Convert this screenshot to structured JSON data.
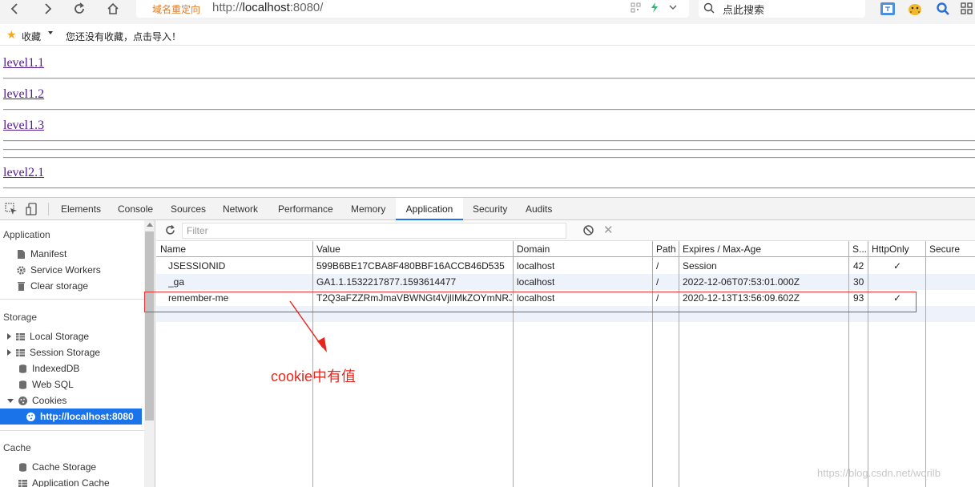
{
  "browser": {
    "address_badge": "域名重定向",
    "url_prefix": "http://",
    "url_host": "localhost",
    "url_suffix": ":8080/",
    "search_placeholder": "点此搜索"
  },
  "bookmarks": {
    "label": "收藏",
    "hint": "您还没有收藏，点击导入！"
  },
  "page": {
    "links": [
      "level1.1",
      "level1.2",
      "level1.3",
      "level2.1"
    ]
  },
  "devtools": {
    "tabs": [
      "Elements",
      "Console",
      "Sources",
      "Network",
      "Performance",
      "Memory",
      "Application",
      "Security",
      "Audits"
    ],
    "active_tab": "Application",
    "sidebar": {
      "application_heading": "Application",
      "application_items": [
        "Manifest",
        "Service Workers",
        "Clear storage"
      ],
      "storage_heading": "Storage",
      "storage_items": [
        "Local Storage",
        "Session Storage",
        "IndexedDB",
        "Web SQL",
        "Cookies"
      ],
      "cookie_origin": "http://localhost:8080",
      "cache_heading": "Cache",
      "cache_items": [
        "Cache Storage",
        "Application Cache"
      ]
    },
    "filter_placeholder": "Filter",
    "columns": [
      "Name",
      "Value",
      "Domain",
      "Path",
      "Expires / Max-Age",
      "S...",
      "HttpOnly",
      "Secure"
    ],
    "cookies": [
      {
        "name": "JSESSIONID",
        "value": "599B6BE17CBA8F480BBF16ACCB46D535",
        "domain": "localhost",
        "path": "/",
        "expires": "Session",
        "size": "42",
        "httponly": "✓",
        "secure": ""
      },
      {
        "name": "_ga",
        "value": "GA1.1.1532217877.1593614477",
        "domain": "localhost",
        "path": "/",
        "expires": "2022-12-06T07:53:01.000Z",
        "size": "30",
        "httponly": "",
        "secure": ""
      },
      {
        "name": "remember-me",
        "value": "T2Q3aFZZRmJmaVBWNGt4VjlIMkZOYmNRJ...",
        "domain": "localhost",
        "path": "/",
        "expires": "2020-12-13T13:56:09.602Z",
        "size": "93",
        "httponly": "✓",
        "secure": ""
      }
    ]
  },
  "annotation": {
    "text": "cookie中有值",
    "color": "#e8261c"
  },
  "watermark": "https://blog.csdn.net/worilb",
  "colors": {
    "accent": "#1a73e8",
    "link_visited": "#551a8b",
    "highlight": "#e33333"
  }
}
